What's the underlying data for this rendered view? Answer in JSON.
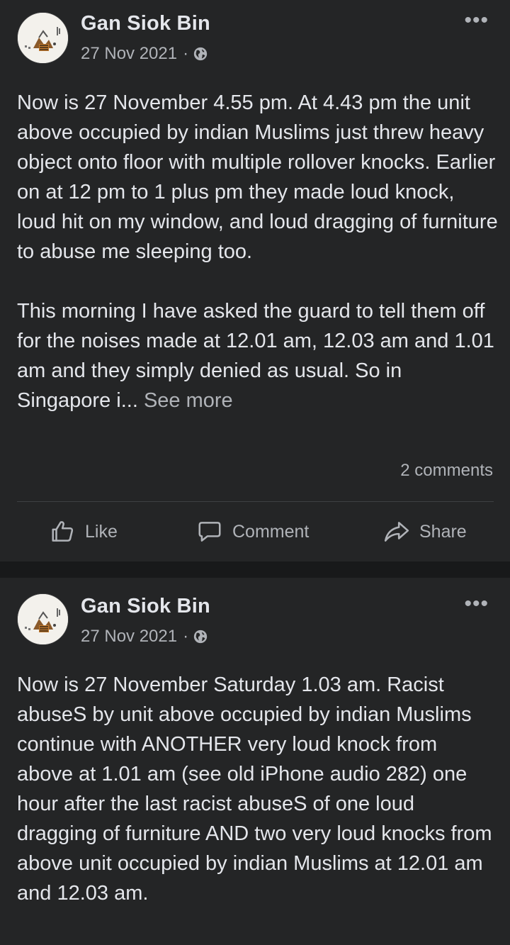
{
  "posts": [
    {
      "author": "Gan Siok Bin",
      "date": "27 Nov 2021",
      "separator": "·",
      "privacy_icon": "globe-icon",
      "more_icon": "more-options-icon",
      "more_label": "•••",
      "text": "Now is 27 November 4.55 pm. At 4.43 pm the unit above occupied by indian Muslims just threw heavy object onto floor with multiple rollover knocks. Earlier on at 12 pm to 1 plus pm they made loud knock, loud hit on my window, and loud dragging of furniture to abuse me sleeping too.\n\nThis morning I have asked the guard to tell them off for the noises made at 12.01 am, 12.03 am and 1.01 am and they simply denied as usual. So in Singapore i...",
      "see_more": "See more",
      "comments_count": "2 comments",
      "actions": {
        "like": "Like",
        "comment": "Comment",
        "share": "Share"
      }
    },
    {
      "author": "Gan Siok Bin",
      "date": "27 Nov 2021",
      "separator": "·",
      "privacy_icon": "globe-icon",
      "more_icon": "more-options-icon",
      "more_label": "•••",
      "text": "Now is 27 November Saturday 1.03 am. Racist abuseS by unit above occupied by indian Muslims continue with ANOTHER very loud knock from above at 1.01 am (see old iPhone audio 282) one hour after the last racist abuseS of one loud dragging of furniture AND two very loud knocks from above unit occupied by indian Muslims at 12.01 am and 12.03 am."
    }
  ],
  "colors": {
    "background": "#18191a",
    "card": "#242526",
    "primary_text": "#e4e6eb",
    "secondary_text": "#b0b3b8",
    "divider": "#3e4042"
  }
}
